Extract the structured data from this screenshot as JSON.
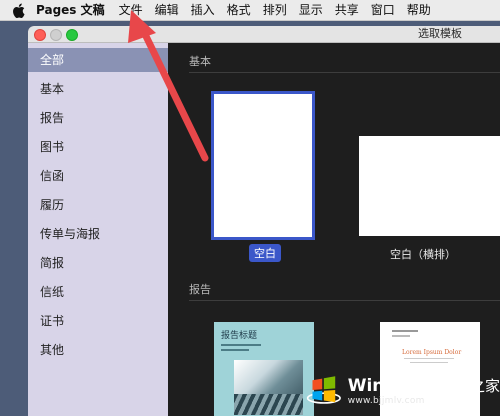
{
  "menubar": {
    "apple_icon": "apple-icon",
    "app_name": "Pages 文稿",
    "items": [
      "文件",
      "编辑",
      "插入",
      "格式",
      "排列",
      "显示",
      "共享",
      "窗口",
      "帮助"
    ]
  },
  "window": {
    "title": "选取模板"
  },
  "sidebar": {
    "items": [
      {
        "label": "全部",
        "selected": true
      },
      {
        "label": "基本"
      },
      {
        "label": "报告"
      },
      {
        "label": "图书"
      },
      {
        "label": "信函"
      },
      {
        "label": "履历"
      },
      {
        "label": "传单与海报"
      },
      {
        "label": "简报"
      },
      {
        "label": "信纸"
      },
      {
        "label": "证书"
      },
      {
        "label": "其他"
      }
    ]
  },
  "sections": {
    "basic": {
      "title": "基本",
      "templates": [
        {
          "label": "空白",
          "selected": true
        },
        {
          "label": "空白（横排）"
        }
      ]
    },
    "report": {
      "title": "报告",
      "templates": [
        {
          "thumb_text": "报告标题"
        },
        {
          "thumb_text": "Lorem Ipsum Dolor"
        }
      ]
    }
  },
  "watermark": {
    "brand": "Windows",
    "brand_cn": "系统之家",
    "url": "www.bjjmlv.com"
  },
  "colors": {
    "selection": "#3b57c9",
    "sidebar_bg": "#d8d4e8",
    "annotation_arrow": "#e8474a"
  }
}
